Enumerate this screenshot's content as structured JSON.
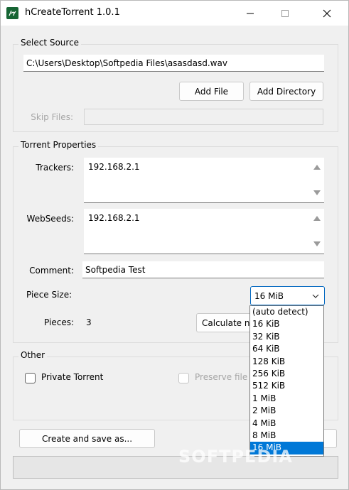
{
  "window": {
    "title": "hCreateTorrent 1.0.1"
  },
  "select_source": {
    "group_label": "Select Source",
    "path_value": "C:\\Users\\Desktop\\Softpedia Files\\asasdasd.wav",
    "add_file_label": "Add File",
    "add_directory_label": "Add Directory",
    "skip_files_label": "Skip Files:",
    "skip_files_value": ""
  },
  "torrent_properties": {
    "group_label": "Torrent Properties",
    "trackers_label": "Trackers:",
    "trackers_value": "192.168.2.1",
    "webseeds_label": "WebSeeds:",
    "webseeds_value": "192.168.2.1",
    "comment_label": "Comment:",
    "comment_value": "Softpedia Test",
    "piece_size_label": "Piece Size:",
    "piece_size_value": "16 MiB",
    "pieces_label": "Pieces:",
    "pieces_value": "3",
    "calculate_label": "Calculate n"
  },
  "piece_size_options": [
    "(auto detect)",
    "16 KiB",
    "32 KiB",
    "64 KiB",
    "128 KiB",
    "256 KiB",
    "512 KiB",
    "1 MiB",
    "2 MiB",
    "4 MiB",
    "8 MiB",
    "16 MiB"
  ],
  "other": {
    "group_label": "Other",
    "private_torrent_label": "Private Torrent",
    "preserve_label": "Preserve file"
  },
  "footer": {
    "create_save_label": "Create and save as...",
    "watermark": "SOFTPEDIA"
  },
  "colors": {
    "accent": "#0078d7",
    "window_bg": "#f0f0f0",
    "icon_bg": "#166534"
  }
}
